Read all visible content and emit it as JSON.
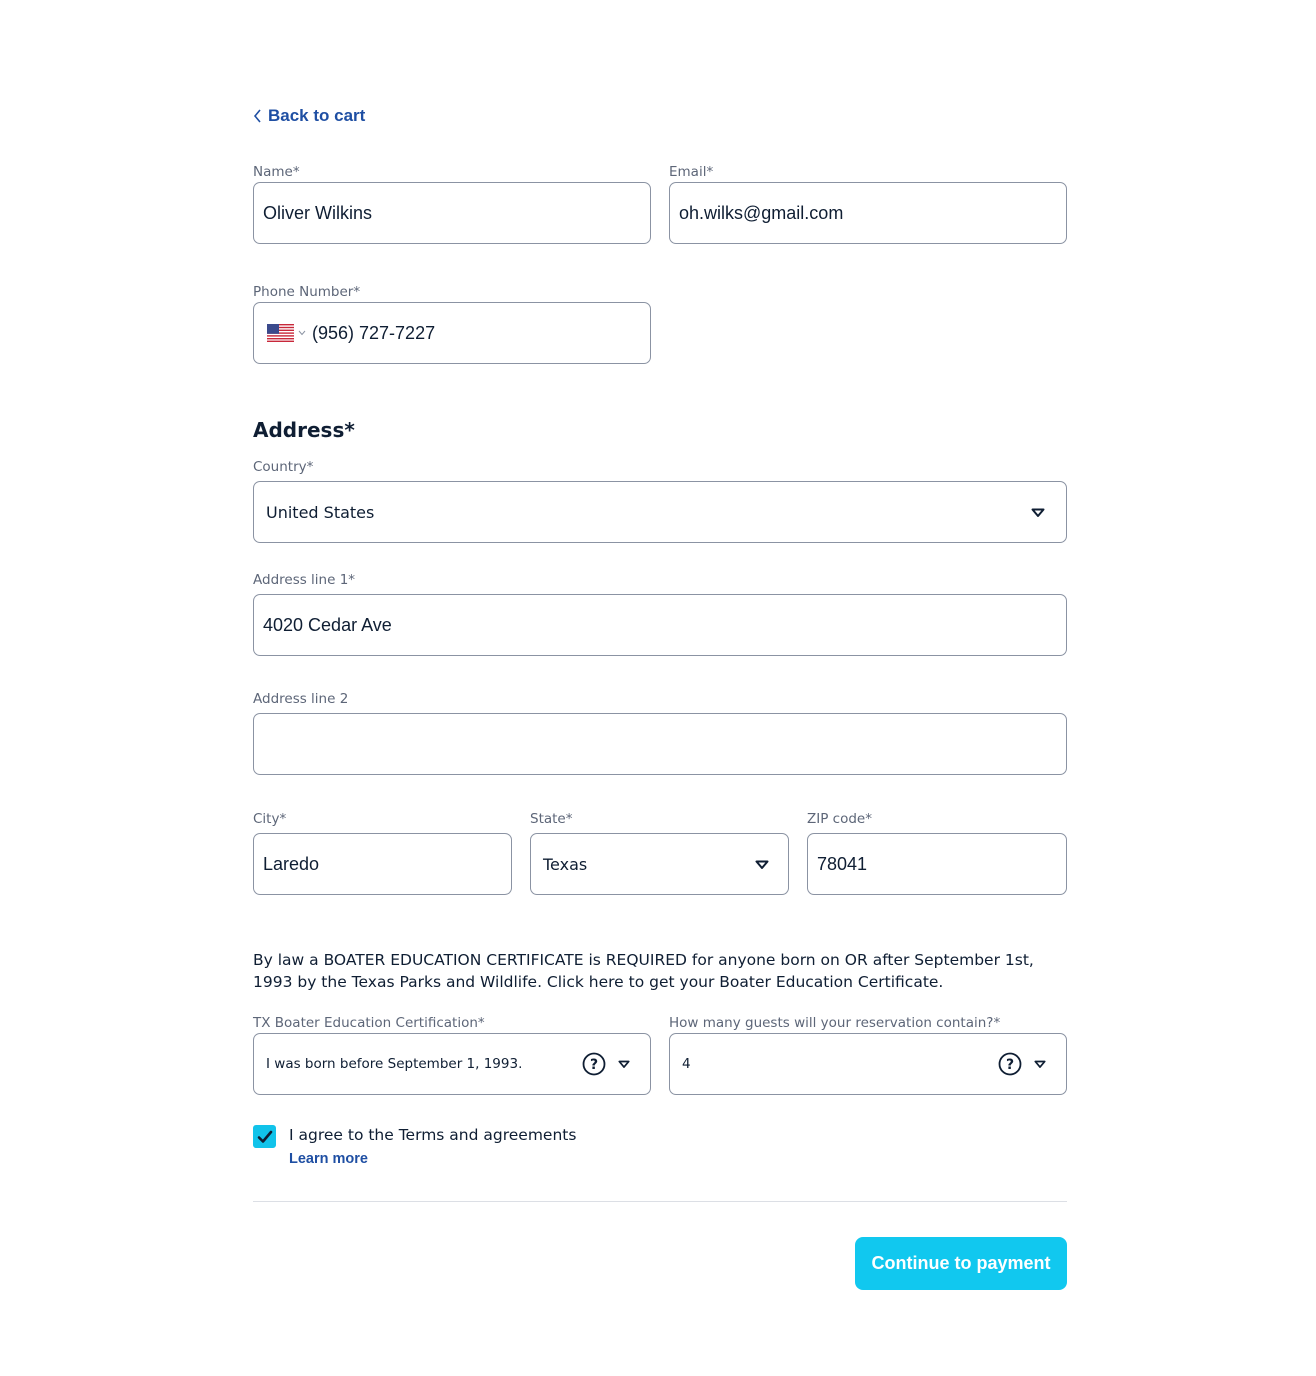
{
  "nav": {
    "back_label": "Back to cart"
  },
  "contact": {
    "name_label": "Name*",
    "name_value": "Oliver Wilkins",
    "email_label": "Email*",
    "email_value": "oh.wilks@gmail.com",
    "phone_label": "Phone Number*",
    "phone_value": "(956) 727-7227"
  },
  "address": {
    "title": "Address*",
    "country_label": "Country*",
    "country_value": "United States",
    "line1_label": "Address line 1*",
    "line1_value": "4020 Cedar Ave",
    "line2_label": "Address line 2",
    "line2_value": "",
    "city_label": "City*",
    "city_value": "Laredo",
    "state_label": "State*",
    "state_value": "Texas",
    "zip_label": "ZIP code*",
    "zip_value": "78041"
  },
  "notice": {
    "text": "By law a BOATER EDUCATION CERTIFICATE is REQUIRED for anyone born on OR after September 1st, 1993 by the Texas Parks and Wildlife. Click here to get your Boater Education Certificate."
  },
  "extras": {
    "cert_label": "TX Boater Education Certification*",
    "cert_value": "I was born before September 1, 1993.",
    "guests_label": "How many guests will your reservation contain?*",
    "guests_value": "4"
  },
  "agreement": {
    "checked": true,
    "label": "I agree to the Terms and agreements",
    "learn_more": "Learn more"
  },
  "footer": {
    "cta_label": "Continue to payment"
  },
  "colors": {
    "accent": "#11c8ef",
    "link": "#1f4fa3",
    "text": "#0f1e33",
    "border": "#8b93a3"
  },
  "icons": {
    "back": "chevron-left-icon",
    "flag": "us-flag-icon",
    "dropdown": "caret-down-icon",
    "help": "question-circle-icon",
    "check": "checkmark-icon"
  }
}
